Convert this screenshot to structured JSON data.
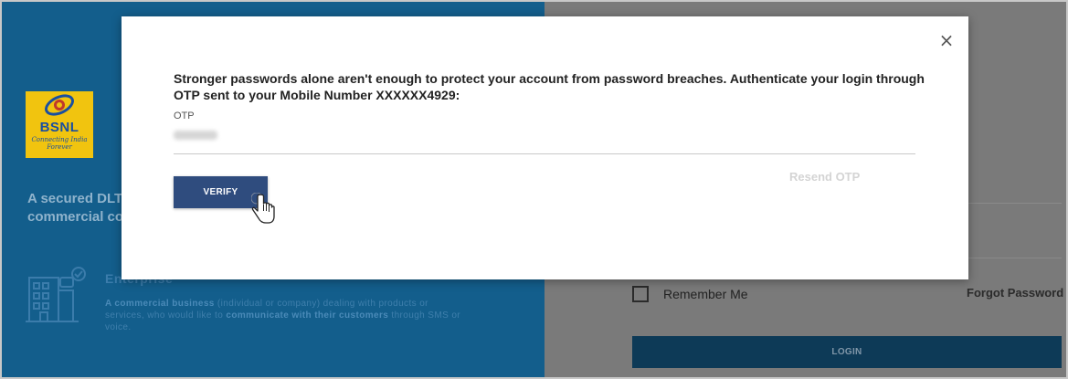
{
  "background": {
    "logo": {
      "name": "BSNL",
      "tagline": "Connecting India Forever"
    },
    "tagline": "A secured DLT\ncommercial co",
    "enterprise": {
      "title": "Enterprise",
      "description_bold_1": "A commercial business",
      "description_1": " (individual or company) dealing with products or services, who would like to ",
      "description_bold_2": "communicate with their customers",
      "description_2": " through SMS or voice."
    },
    "login_form": {
      "remember_label": "Remember Me",
      "forgot_label": "Forgot Password",
      "login_label": "LOGIN"
    },
    "colors": {
      "left_panel": "#135e8c",
      "overlay": "#7a7a7a"
    }
  },
  "modal": {
    "close_label": "×",
    "message": "Stronger passwords alone aren't enough to protect your account from password breaches. Authenticate your login through OTP sent to your Mobile Number XXXXXX4929:",
    "otp_label": "OTP",
    "otp_value": "",
    "resend_label": "Resend OTP",
    "verify_label": "VERIFY",
    "colors": {
      "verify_button": "#2f4c7e"
    }
  },
  "icons": {
    "cursor": "hand-pointer-icon",
    "enterprise": "building-chat-icon",
    "close": "close-icon"
  }
}
